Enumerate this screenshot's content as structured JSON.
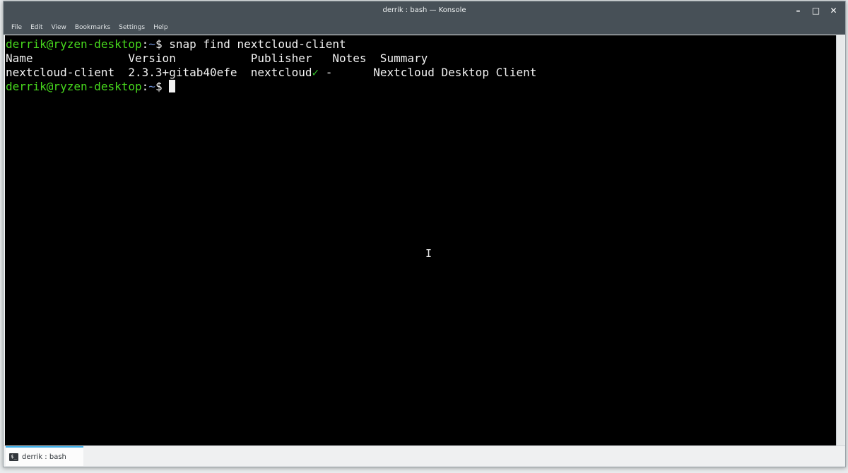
{
  "window": {
    "title": "derrik : bash — Konsole",
    "controls": {
      "minimize": "–",
      "maximize": "□",
      "close": "✕"
    }
  },
  "menubar": [
    "File",
    "Edit",
    "View",
    "Bookmarks",
    "Settings",
    "Help"
  ],
  "terminal": {
    "prompt_user_host": "derrik@ryzen-desktop",
    "prompt_colon": ":",
    "prompt_path": "~",
    "prompt_symbol": "$ ",
    "command": "snap find nextcloud-client",
    "table_header": "Name              Version           Publisher   Notes  Summary",
    "row_name_version": "nextcloud-client  2.3.3+gitab40efe  nextcloud",
    "row_check": "✓",
    "row_rest": " -      Nextcloud Desktop Client"
  },
  "tab": {
    "label": "derrik : bash",
    "icon": "$_"
  },
  "colors": {
    "titlebar": "#475057",
    "prompt_user": "#47d81d",
    "prompt_path": "#6a8ccf",
    "accent": "#3daee9"
  }
}
